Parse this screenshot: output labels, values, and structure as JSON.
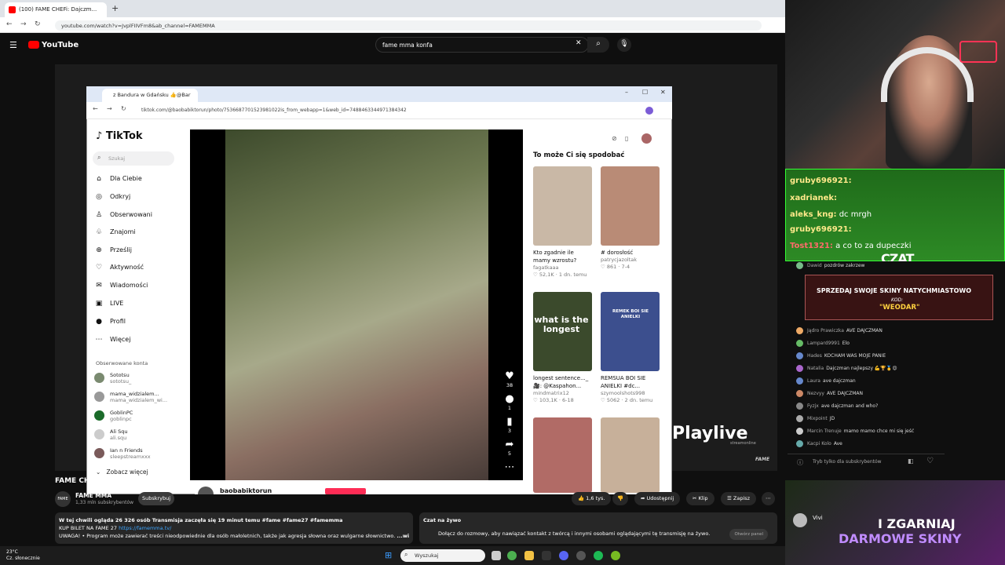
{
  "outer_browser": {
    "tab_title": "(100) FAME CHEFi: Dajczm...",
    "url": "youtube.com/watch?v=JvplFIIVFm8&ab_channel=FAMEMMA"
  },
  "youtube": {
    "logo": "YouTube",
    "search_query": "fame mma konfa",
    "video_title": "FAME CH",
    "channel": {
      "name": "FAME MMA",
      "subs": "1,33 mln subskrybentów",
      "subscribe_label": "Subskrybuj"
    },
    "actions": {
      "likes": "1,6 tys.",
      "share": "Udostępnij",
      "clip": "Klip",
      "save": "Zapisz"
    },
    "description": {
      "line1": "W tej chwili ogląda 26 326 osób  Transmisja zaczęła się 19 minut temu  #fame #fame27 #famemma",
      "line2_prefix": "KUP BILET NA FAME 27",
      "line2_link": "https://famemma.tv/",
      "line3": "UWAGA! • Program może zawierać treści nieodpowiednie dla osób małoletnich, także jak agresja słowna oraz wulgarne słownictwo.",
      "more": "...więcej"
    },
    "live_chat": {
      "title": "Czat na żywo",
      "text": "Dołącz do rozmowy, aby nawiązać kontakt z twórcą i innymi osobami oglądającymi tę transmisję na żywo.",
      "open_panel": "Otwórz panel"
    },
    "overlay": {
      "playlive": "Playlive",
      "playlive_sub": "streamonline",
      "fame_mark": "FAME"
    }
  },
  "inner_browser": {
    "tab_title": "z Bandura w Gdańsku 👍@Bar",
    "url": "tiktok.com/@baobabiktorun/photo/7536687701523981022is_from_webapp=1&web_id=7488463344971384342"
  },
  "tiktok": {
    "logo": "TikTok",
    "search_placeholder": "Szukaj",
    "nav": [
      {
        "icon": "⌂",
        "label": "Dla Ciebie"
      },
      {
        "icon": "◎",
        "label": "Odkryj"
      },
      {
        "icon": "♙",
        "label": "Obserwowani"
      },
      {
        "icon": "♧",
        "label": "Znajomi"
      },
      {
        "icon": "⊕",
        "label": "Prześlij"
      },
      {
        "icon": "♡",
        "label": "Aktywność"
      },
      {
        "icon": "✉",
        "label": "Wiadomości"
      },
      {
        "icon": "▣",
        "label": "LIVE"
      },
      {
        "icon": "●",
        "label": "Profil"
      },
      {
        "icon": "⋯",
        "label": "Więcej"
      }
    ],
    "followed_header": "Obserwowane konta",
    "followed": [
      {
        "name": "Sototsu",
        "handle": "sototsu_"
      },
      {
        "name": "mama_widzialem...",
        "handle": "mama_widzialem_wi..."
      },
      {
        "name": "GoblinPC",
        "handle": "goblinpc"
      },
      {
        "name": "Ali Squ",
        "handle": "ali.squ"
      },
      {
        "name": "Ian n Friends",
        "handle": "sleepstreamxxx"
      }
    ],
    "see_more": "Zobacz więcej",
    "video_side": {
      "likes": "38",
      "comments": "1",
      "saves": "3",
      "shares": "5"
    },
    "author": "baobabiktorun",
    "recommend_title": "To może Ci się spodobać",
    "cards": [
      {
        "title": "Kto zgadnie ile mamy wzrostu?",
        "author": "fagatkaaa",
        "stats": "♡ 52,1K · 1 dn. temu",
        "color": "#c9b8a6"
      },
      {
        "title": "# dorosłość",
        "author": "patrycjazoltak",
        "stats": "♡ 861 · 7-4",
        "color": "#b98b76"
      },
      {
        "title": "longest sentence..._ 🎥: @Kaspahon...",
        "author": "mindmatrix12",
        "stats": "♡ 103,1K · 6-18",
        "color": "#3b4a2c"
      },
      {
        "title": "REMSUA BOI SIE ANIELKI #dc...",
        "author": "szymoolshots998",
        "stats": "♡ 5062 · 2 dn. temu",
        "color": "#3c4f8e"
      },
      {
        "title": "",
        "author": "",
        "stats": "",
        "color": "#b16b66"
      },
      {
        "title": "",
        "author": "",
        "stats": "",
        "color": "#c7b09a"
      }
    ],
    "card_overlays": {
      "c3": "what is the longest",
      "c4": "REMEK BOI SIE ANIELKI"
    }
  },
  "stream_chat": {
    "lines": [
      {
        "user": "gruby696921:",
        "msg": ""
      },
      {
        "user": "xadrianek:",
        "msg": ""
      },
      {
        "user": "aleks_kng:",
        "msg": "dc mrgh"
      },
      {
        "user": "gruby696921:",
        "msg": ""
      },
      {
        "user": "Tost1321:",
        "msg": "a co to za dupeczki"
      }
    ],
    "czat_label": "CZAT"
  },
  "promo": {
    "line1": "SPRZEDAJ SWOJE SKINY NATYCHMIASTOWO",
    "kod_label": "KOD:",
    "kod": "\"WEODAR\"",
    "big1": "I ZGARNIAJ",
    "big2": "DARMOWE SKINY",
    "side_text": "Vivi"
  },
  "yt_chat": {
    "messages": [
      {
        "name": "Dawid",
        "msg": "pozdrów zakrzew"
      },
      {
        "name": "Jądro Prawiczka",
        "msg": "AVE DAJCZMAN"
      },
      {
        "name": "Lampard9991",
        "msg": "Elo"
      },
      {
        "name": "Hades",
        "msg": "KOCHAM WAS MOJE PANIE"
      },
      {
        "name": "Natalia",
        "msg": "Dajczman najlepszy 💪🏆🥇😍"
      },
      {
        "name": "Laura",
        "msg": "ave dajczman"
      },
      {
        "name": "Nezvyy",
        "msg": "AVE DAJCZMAN"
      },
      {
        "name": "Fyzjx",
        "msg": "ave dajczman and who?"
      },
      {
        "name": "Mixpoint",
        "msg": "JD"
      },
      {
        "name": "Marcin Trenuje",
        "msg": "mamo mamo chce mi się jeść"
      },
      {
        "name": "Kacpi Kolo",
        "msg": "Ave"
      }
    ],
    "subscribers_only": "Tryb tylko dla subskrybentów"
  },
  "taskbar": {
    "temp": "23°C",
    "weather": "Cz. słonecznie",
    "search": "Wyszukaj"
  }
}
